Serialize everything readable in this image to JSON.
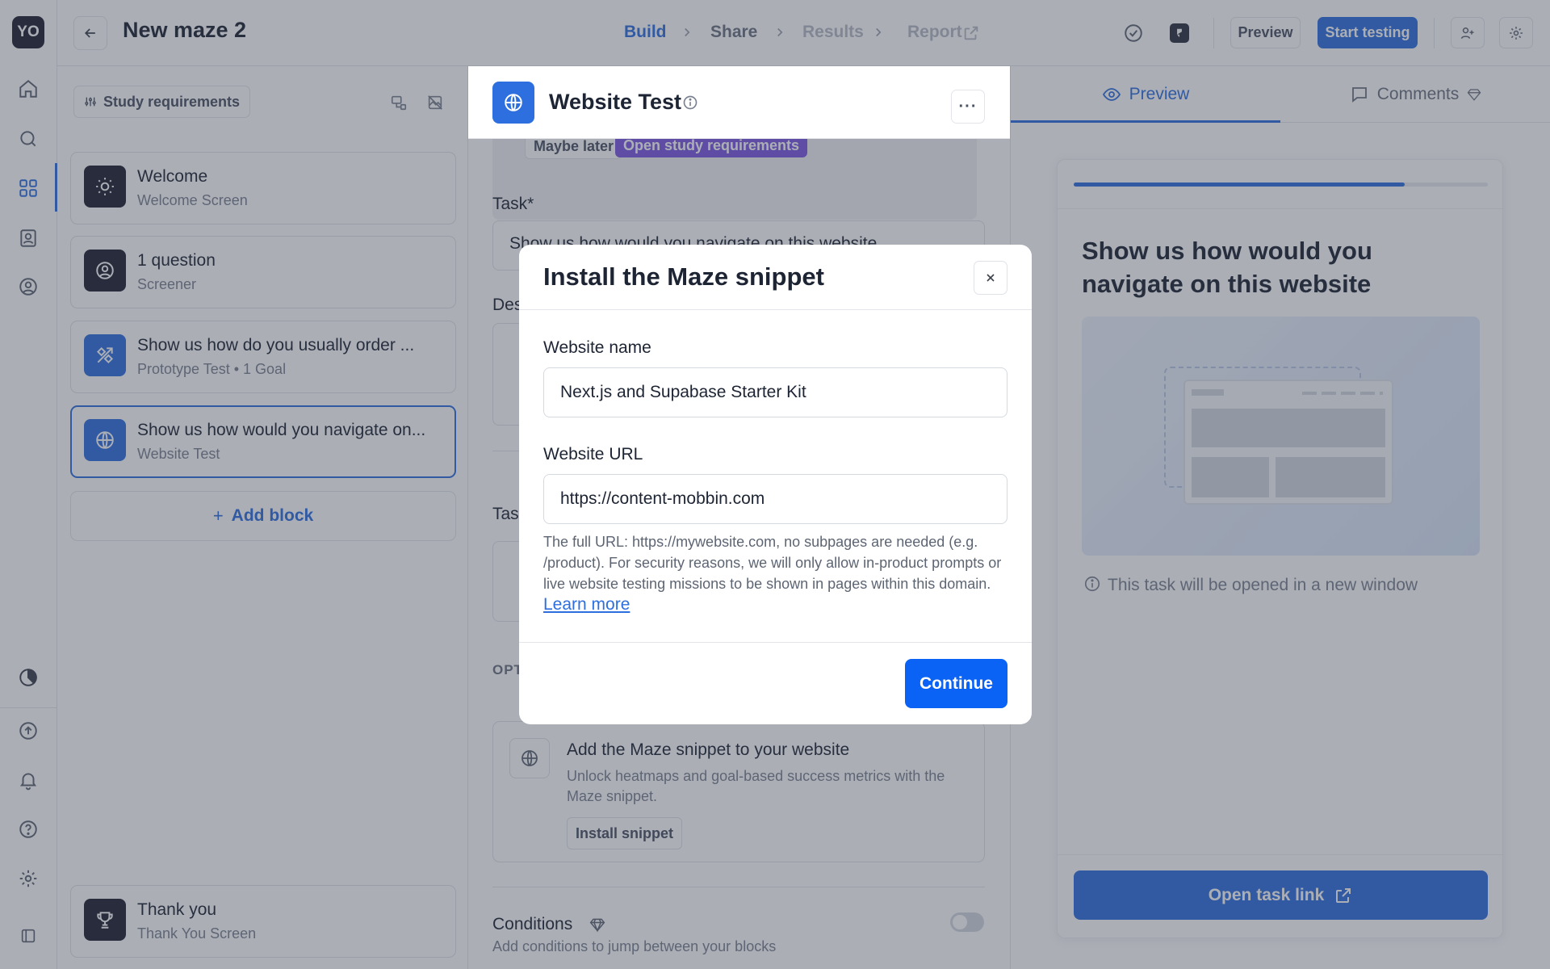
{
  "rail": {
    "avatar": "YO"
  },
  "topbar": {
    "title": "New maze 2",
    "crumbs": [
      "Build",
      "Share",
      "Results",
      "Report"
    ],
    "preview_label": "Preview",
    "start_label": "Start testing"
  },
  "left": {
    "requirements_label": "Study requirements",
    "blocks": [
      {
        "title": "Welcome",
        "subtitle": "Welcome Screen"
      },
      {
        "title": "1 question",
        "subtitle": "Screener"
      },
      {
        "title": "Show us how do you usually order ...",
        "subtitle": "Prototype Test • 1 Goal"
      },
      {
        "title": "Show us how would you navigate on...",
        "subtitle": "Website Test"
      }
    ],
    "add_block_label": "Add block",
    "thankyou": {
      "title": "Thank you",
      "subtitle": "Thank You Screen"
    }
  },
  "middle": {
    "header_title": "Website Test",
    "maybe_later": "Maybe later",
    "open_requirements": "Open study requirements",
    "task_label": "Task*",
    "task_value": "Show us how would you navigate on this website",
    "description_label": "Des",
    "tasks_label": "Tas",
    "options_label": "OPT",
    "snippet_title": "Add the Maze snippet to your website",
    "snippet_desc": "Unlock heatmaps and goal-based success metrics with the Maze snippet.",
    "install_snippet": "Install snippet",
    "conditions_title": "Conditions",
    "conditions_desc": "Add conditions to jump between your blocks"
  },
  "right": {
    "tab_preview": "Preview",
    "tab_comments": "Comments",
    "progress": 0.8,
    "preview_title": "Show us how would you navigate on this website",
    "note": "This task will be opened in a new window",
    "open_task_link": "Open task link"
  },
  "modal": {
    "title": "Install the Maze snippet",
    "website_name_label": "Website name",
    "website_name_value": "Next.js and Supabase Starter Kit",
    "website_url_label": "Website URL",
    "website_url_value": "https://content-mobbin.com",
    "help_text": "The full URL: https://mywebsite.com, no subpages are needed (e.g. /product). For security reasons, we will only allow in-product prompts or live website testing missions to be shown in pages within this domain.",
    "learn_more": "Learn more",
    "continue_label": "Continue"
  },
  "colors": {
    "accent": "#2d6fdf",
    "primary_button": "#0b63f6",
    "dark_tile": "#1e2030",
    "purple": "#7b57e4"
  }
}
